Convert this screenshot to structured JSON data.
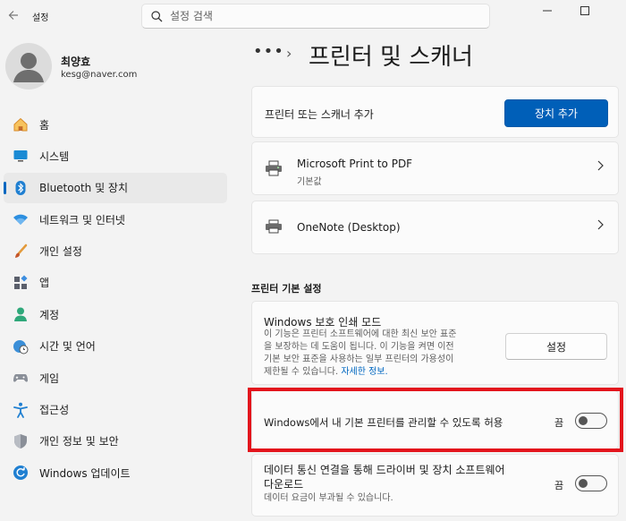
{
  "app": {
    "title": "설정"
  },
  "search": {
    "placeholder": "설정 검색"
  },
  "user": {
    "name": "최양효",
    "email": "kesg@naver.com"
  },
  "sidebar": {
    "items": [
      {
        "label": "홈",
        "icon": "home-icon"
      },
      {
        "label": "시스템",
        "icon": "monitor-icon"
      },
      {
        "label": "Bluetooth 및 장치",
        "icon": "bluetooth-icon",
        "active": true
      },
      {
        "label": "네트워크 및 인터넷",
        "icon": "wifi-icon"
      },
      {
        "label": "개인 설정",
        "icon": "brush-icon"
      },
      {
        "label": "앱",
        "icon": "apps-icon"
      },
      {
        "label": "계정",
        "icon": "account-icon"
      },
      {
        "label": "시간 및 언어",
        "icon": "globe-clock-icon"
      },
      {
        "label": "게임",
        "icon": "gamepad-icon"
      },
      {
        "label": "접근성",
        "icon": "accessibility-icon"
      },
      {
        "label": "개인 정보 및 보안",
        "icon": "shield-icon"
      },
      {
        "label": "Windows 업데이트",
        "icon": "update-icon"
      }
    ]
  },
  "breadcrumb": {
    "dots": "•••",
    "separator": "›"
  },
  "page": {
    "title": "프린터 및 스캐너"
  },
  "add_device": {
    "label": "프린터 또는 스캐너 추가",
    "button": "장치 추가"
  },
  "printers": [
    {
      "name": "Microsoft Print to PDF",
      "sub": "기본값"
    },
    {
      "name": "OneNote (Desktop)",
      "sub": ""
    }
  ],
  "preferences": {
    "title": "프린터 기본 설정",
    "protected_mode": {
      "title": "Windows 보호 인쇄 모드",
      "desc_lines": [
        "이 기능은 프린터 소프트웨어에 대한 최신 보안 표준",
        "을 보장하는 데 도움이 됩니다. 이 기능을 켜면 이전",
        "기본 보안 표준을 사용하는 일부 프린터의 가용성이",
        "제한될 수 있습니다. "
      ],
      "link": "자세한 정보.",
      "button": "설정"
    },
    "manage_default": {
      "label": "Windows에서 내 기본 프린터를 관리할 수 있도록 허용",
      "state": "끔"
    },
    "metered": {
      "title_lines": [
        "데이터 통신 연결을 통해 드라이버 및 장치 소프트웨어",
        "다운로드"
      ],
      "desc": "데이터 요금이 부과될 수 있습니다.",
      "state": "끔"
    }
  },
  "colors": {
    "accent": "#005fb8",
    "highlight": "#e3141c"
  }
}
